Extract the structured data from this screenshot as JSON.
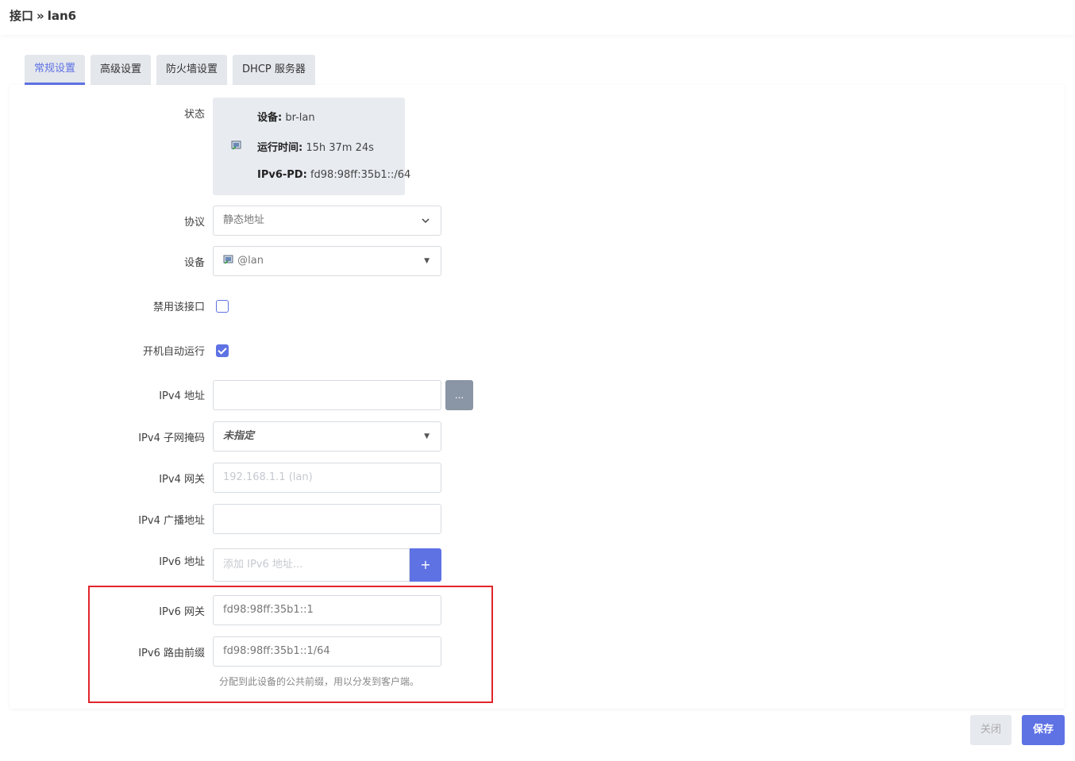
{
  "breadcrumb": {
    "parent": "接口",
    "separator": "»",
    "current": "lan6"
  },
  "tabs": [
    {
      "label": "常规设置",
      "active": true
    },
    {
      "label": "高级设置",
      "active": false
    },
    {
      "label": "防火墙设置",
      "active": false
    },
    {
      "label": "DHCP 服务器",
      "active": false
    }
  ],
  "status": {
    "label": "状态",
    "device_key": "设备:",
    "device_value": "br-lan",
    "uptime_key": "运行时间:",
    "uptime_value": "15h 37m 24s",
    "pd_key": "IPv6-PD:",
    "pd_value": "fd98:98ff:35b1::/64"
  },
  "protocol": {
    "label": "协议",
    "value": "静态地址"
  },
  "device": {
    "label": "设备",
    "value": "@lan"
  },
  "disable_iface": {
    "label": "禁用该接口",
    "checked": false
  },
  "autostart": {
    "label": "开机自动运行",
    "checked": true
  },
  "ipv4_address": {
    "label": "IPv4 地址",
    "value": "",
    "button": "..."
  },
  "ipv4_netmask": {
    "label": "IPv4 子网掩码",
    "value": "未指定"
  },
  "ipv4_gateway": {
    "label": "IPv4 网关",
    "placeholder": "192.168.1.1 (lan)"
  },
  "ipv4_broadcast": {
    "label": "IPv4 广播地址",
    "value": ""
  },
  "ipv6_address": {
    "label": "IPv6 地址",
    "placeholder": "添加 IPv6 地址...",
    "button": "+"
  },
  "ipv6_gateway": {
    "label": "IPv6 网关",
    "value": "fd98:98ff:35b1::1"
  },
  "ipv6_prefix": {
    "label": "IPv6 路由前缀",
    "value": "fd98:98ff:35b1::1/64",
    "hint": "分配到此设备的公共前缀，用以分发到客户端。"
  },
  "footer": {
    "close_label": "关闭",
    "save_label": "保存"
  },
  "colors": {
    "accent": "#5e72e4",
    "highlight_border": "#e0262b"
  }
}
